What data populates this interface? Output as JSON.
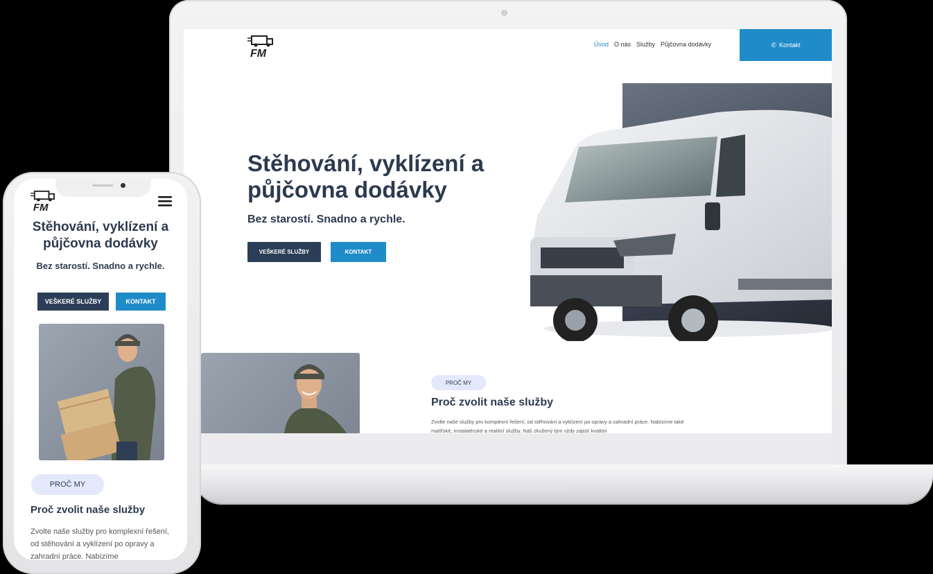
{
  "site": {
    "logo_text": "FM",
    "nav": [
      {
        "label": "Úvod",
        "active": true
      },
      {
        "label": "O nás",
        "active": false
      },
      {
        "label": "Služby",
        "active": false
      },
      {
        "label": "Půjčovna dodávky",
        "active": false
      }
    ],
    "contact_label": "Kontakt",
    "hero_title": "Stěhování, vyklízení a půjčovna dodávky",
    "hero_subtitle": "Bez starostí. Snadno a rychle.",
    "btn_services": "VEŠKERÉ SLUŽBY",
    "btn_contact": "KONTAKT",
    "badge": "PROČ MY",
    "why_title": "Proč zvolit naše služby",
    "why_text_laptop": "Zvolte naše služby pro komplexní řešení, od stěhování a vyklízení po opravy a zahradní práce. Nabízíme také malířské, instalatérské a realitní služby. Náš zkušený tým vždy zajistí kvalitní",
    "why_text_phone": "Zvolte naše služby pro komplexní řešení, od stěhování a vyklízení po opravy a zahradní práce. Nabízíme"
  },
  "colors": {
    "primary": "#1f8cc9",
    "dark": "#2c3e57",
    "heading": "#2c3a4f",
    "badge_bg": "#e4e8fb"
  }
}
